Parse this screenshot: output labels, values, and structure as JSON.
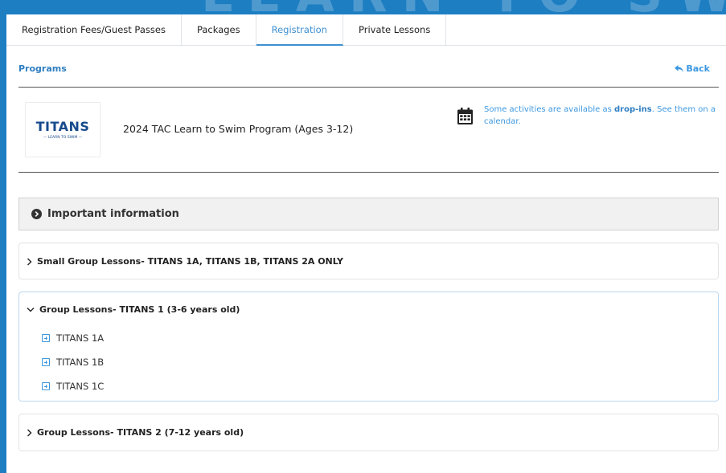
{
  "brand": {
    "accent": "#3d8fd1",
    "link": "#2f7fc1",
    "frame": "#1d7ec2",
    "watermark": "LEARN TO SWIM"
  },
  "tabs": [
    {
      "label": "Registration Fees/Guest Passes",
      "active": false
    },
    {
      "label": "Packages",
      "active": false
    },
    {
      "label": "Registration",
      "active": true
    },
    {
      "label": "Private Lessons",
      "active": false
    }
  ],
  "breadcrumb": {
    "programs": "Programs",
    "back": "Back",
    "back_icon": "reply-arrow-icon"
  },
  "program": {
    "logo_text": "TITANS",
    "logo_sub": "— LEARN TO SWIM —",
    "title": "2024 TAC Learn to Swim Program (Ages 3-12)",
    "calendar_icon": "calendar-icon",
    "dropin_prefix": "Some activities are available as ",
    "dropin_bold": "drop-ins",
    "dropin_suffix": ". See them on a calendar."
  },
  "info": {
    "icon": "circle-chevron-right-icon",
    "label": "Important information"
  },
  "sections": [
    {
      "title": "Small Group Lessons- TITANS 1A, TITANS 1B, TITANS 2A ONLY",
      "expanded": false,
      "items": []
    },
    {
      "title": "Group Lessons- TITANS 1 (3-6 years old)",
      "expanded": true,
      "items": [
        "TITANS 1A",
        "TITANS 1B",
        "TITANS 1C"
      ]
    },
    {
      "title": "Group Lessons- TITANS 2 (7-12 years old)",
      "expanded": false,
      "items": []
    }
  ]
}
